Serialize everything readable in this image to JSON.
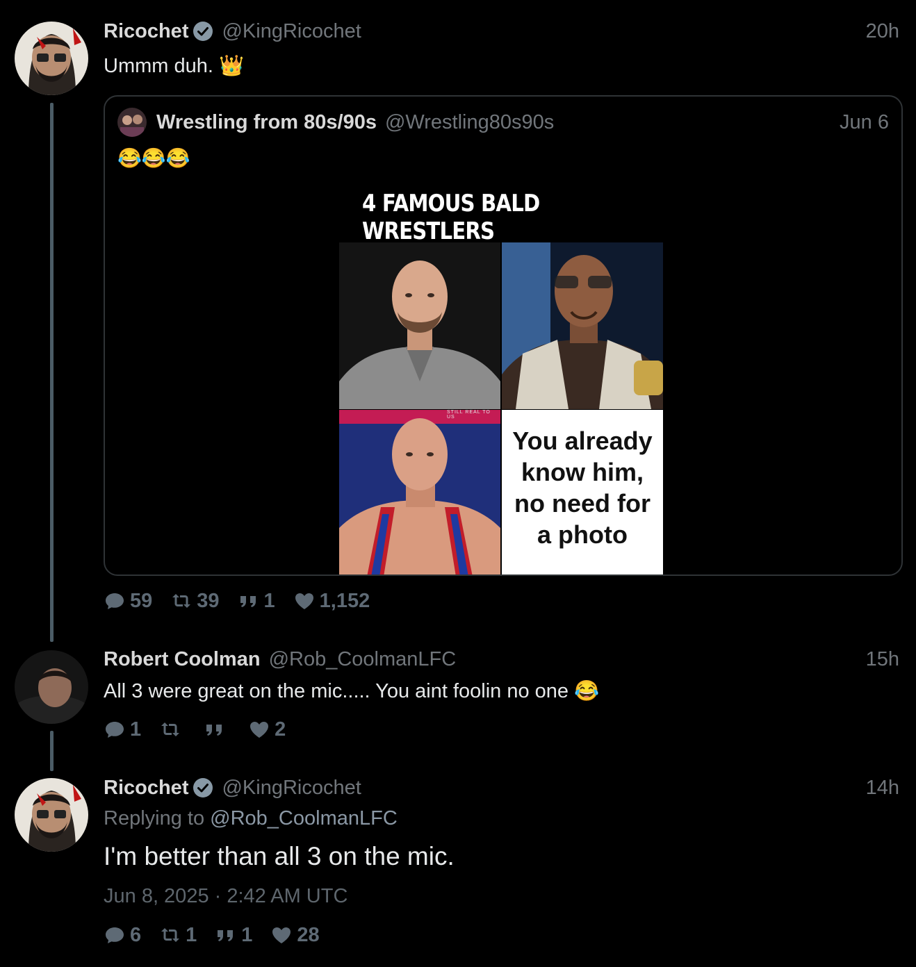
{
  "tweet1": {
    "name": "Ricochet",
    "handle": "@KingRicochet",
    "time": "20h",
    "text": "Ummm duh. 👑",
    "quote": {
      "name": "Wrestling from 80s/90s",
      "handle": "@Wrestling80s90s",
      "time": "Jun 6",
      "text": "😂😂😂",
      "meme": {
        "title": "4 FAMOUS BALD WRESTLERS",
        "caption_small": "STILL REAL TO US",
        "panel4_lines": [
          "You already",
          "know him,",
          "no need for",
          "a photo"
        ]
      }
    },
    "stats": {
      "replies": "59",
      "retweets": "39",
      "quotes": "1",
      "likes": "1,152"
    }
  },
  "tweet2": {
    "name": "Robert Coolman",
    "handle": "@Rob_CoolmanLFC",
    "time": "15h",
    "text": "All 3 were great on the mic..... You aint foolin no one 😂",
    "stats": {
      "replies": "1",
      "retweets": "",
      "quotes": "",
      "likes": "2"
    }
  },
  "tweet3": {
    "name": "Ricochet",
    "handle": "@KingRicochet",
    "time": "14h",
    "replying_prefix": "Replying to",
    "replying_mention": "@Rob_CoolmanLFC",
    "text": "I'm better than all 3 on the mic.",
    "date": "Jun 8, 2025 · 2:42 AM UTC",
    "stats": {
      "replies": "6",
      "retweets": "1",
      "quotes": "1",
      "likes": "28"
    }
  },
  "icons": {
    "reply": "reply-bubble-icon",
    "retweet": "retweet-icon",
    "quote": "quote-marks-icon",
    "like": "heart-icon",
    "verified": "verified-badge-icon"
  },
  "colors": {
    "background": "#000000",
    "muted": "#71767b",
    "thread_line": "#4b5c66",
    "verified_badge": "#8899a6"
  }
}
